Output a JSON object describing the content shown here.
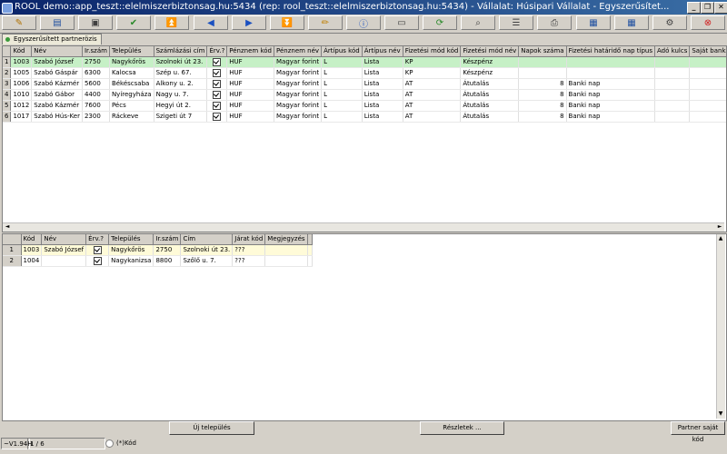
{
  "window": {
    "title": "ROOL demo::app_teszt::elelmiszerbiztonsag.hu:5434 (rep: rool_teszt::elelmiszerbiztonsag.hu:5434) - Vállalat: Húsipari Vállalat - Egyszerűsítet...",
    "minimize": "_",
    "restore": "❐",
    "close": "✕"
  },
  "toolbar": [
    {
      "name": "edit-icon",
      "glyph": "✎",
      "color": "#b07000"
    },
    {
      "name": "open-folder-icon",
      "glyph": "▤",
      "color": "#2050a0"
    },
    {
      "name": "save-icon",
      "glyph": "▣",
      "color": "#404040"
    },
    {
      "name": "check-icon",
      "glyph": "✔",
      "color": "#2a8a2a"
    },
    {
      "name": "first-record-icon",
      "glyph": "⏫",
      "color": "#1a50c0"
    },
    {
      "name": "prev-record-icon",
      "glyph": "◀",
      "color": "#1a50c0"
    },
    {
      "name": "next-record-icon",
      "glyph": "▶",
      "color": "#1a50c0"
    },
    {
      "name": "last-record-icon",
      "glyph": "⏬",
      "color": "#1a50c0"
    },
    {
      "name": "pencil-icon",
      "glyph": "✏",
      "color": "#c08000"
    },
    {
      "name": "info-icon",
      "glyph": "ⓘ",
      "color": "#1a50c0"
    },
    {
      "name": "window-icon",
      "glyph": "▭",
      "color": "#404040"
    },
    {
      "name": "refresh-icon",
      "glyph": "⟳",
      "color": "#2a8a2a"
    },
    {
      "name": "search-icon",
      "glyph": "⌕",
      "color": "#404040"
    },
    {
      "name": "table-icon",
      "glyph": "☰",
      "color": "#404040"
    },
    {
      "name": "print-icon",
      "glyph": "⎙",
      "color": "#404040"
    },
    {
      "name": "grid-icon",
      "glyph": "▦",
      "color": "#2050a0"
    },
    {
      "name": "export-icon",
      "glyph": "▦",
      "color": "#2050a0"
    },
    {
      "name": "settings-icon",
      "glyph": "⚙",
      "color": "#404040"
    },
    {
      "name": "exit-icon",
      "glyph": "⊗",
      "color": "#d02020"
    }
  ],
  "tab": {
    "label": "Egyszerűsített partnerözis"
  },
  "top_grid": {
    "headers": [
      "Kód",
      "Név",
      "Ir.szám",
      "Település",
      "Számlázási cím",
      "Érv.?",
      "Pénznem kód",
      "Pénznem név",
      "Ártípus kód",
      "Ártípus név",
      "Fizetési mód kód",
      "Fizetési mód név",
      "Napok száma",
      "Fizetési határidő nap típus",
      "Adó kulcs",
      "Saját bankszámla"
    ],
    "rows": [
      {
        "n": "1",
        "cells": [
          "1003",
          "Szabó József",
          "2750",
          "Nagykőrös",
          "Szolnoki út 23.",
          "✓",
          "HUF",
          "Magyar forint",
          "L",
          "Lista",
          "KP",
          "Készpénz",
          "",
          "",
          "",
          ""
        ]
      },
      {
        "n": "2",
        "cells": [
          "1005",
          "Szabó Gáspár",
          "6300",
          "Kalocsa",
          "Szép u. 67.",
          "✓",
          "HUF",
          "Magyar forint",
          "L",
          "Lista",
          "KP",
          "Készpénz",
          "",
          "",
          "",
          ""
        ]
      },
      {
        "n": "3",
        "cells": [
          "1006",
          "Szabó Kázmér",
          "5600",
          "Békéscsaba",
          "Alkony u. 2.",
          "✓",
          "HUF",
          "Magyar forint",
          "L",
          "Lista",
          "AT",
          "Átutalás",
          "8",
          "Banki nap",
          "",
          ""
        ]
      },
      {
        "n": "4",
        "cells": [
          "1010",
          "Szabó Gábor",
          "4400",
          "Nyíregyháza",
          "Nagy u. 7.",
          "✓",
          "HUF",
          "Magyar forint",
          "L",
          "Lista",
          "AT",
          "Átutalás",
          "8",
          "Banki nap",
          "",
          ""
        ]
      },
      {
        "n": "5",
        "cells": [
          "1012",
          "Szabó Kázmér",
          "7600",
          "Pécs",
          "Hegyi út 2.",
          "✓",
          "HUF",
          "Magyar forint",
          "L",
          "Lista",
          "AT",
          "Átutalás",
          "8",
          "Banki nap",
          "",
          ""
        ]
      },
      {
        "n": "6",
        "cells": [
          "1017",
          "Szabó Hús-Ker",
          "2300",
          "Ráckeve",
          "Szigeti út 7",
          "✓",
          "HUF",
          "Magyar forint",
          "L",
          "Lista",
          "AT",
          "Átutalás",
          "8",
          "Banki nap",
          "",
          ""
        ]
      }
    ]
  },
  "bottom_grid": {
    "headers": [
      "Kód",
      "Név",
      "Érv.?",
      "Település",
      "Ir.szám",
      "Cím",
      "Járat kód",
      "Megjegyzés"
    ],
    "rows": [
      {
        "n": "1",
        "cells": [
          "1003",
          "Szabó József",
          "✓",
          "Nagykőrös",
          "2750",
          "Szolnoki út 23.",
          "???",
          ""
        ]
      },
      {
        "n": "2",
        "cells": [
          "1004",
          "",
          "✓",
          "Nagykanizsa",
          "8800",
          "Szőlő u. 7.",
          "???",
          ""
        ]
      }
    ]
  },
  "buttons": {
    "new_settlement": "Új település",
    "details": "Részletek ...",
    "partner_own_code": "Partner saját kód"
  },
  "status": {
    "version": "~V1.94H",
    "record": "1 / 6",
    "mode": "(*)Kód"
  }
}
